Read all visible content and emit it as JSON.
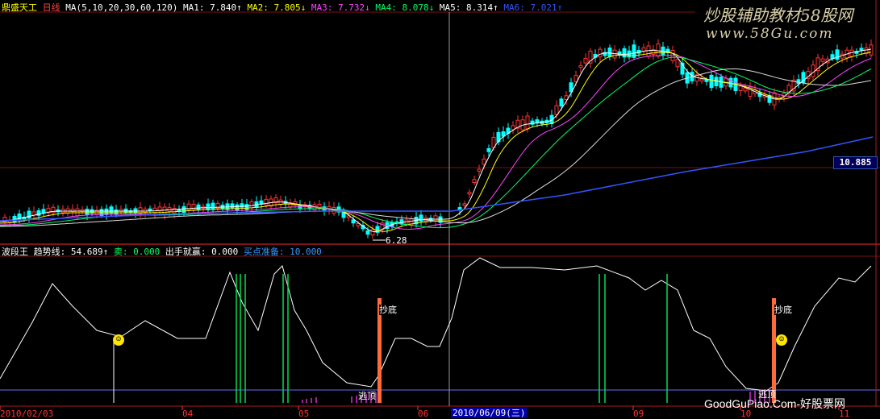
{
  "top_bar": {
    "stock_name": "鼎盛天工",
    "period": "日线",
    "ma_params": "MA(5,10,20,30,60,120)",
    "ma": [
      {
        "label": "MA1: 7.840↑",
        "color": "#ffffff"
      },
      {
        "label": "MA2: 7.805↓",
        "color": "#ffff00"
      },
      {
        "label": "MA3: 7.732↓",
        "color": "#ff44ff"
      },
      {
        "label": "MA4: 8.078↓",
        "color": "#00ff66"
      },
      {
        "label": "MA5: 8.314↑",
        "color": "#ffffff"
      },
      {
        "label": "MA6: 7.021↑",
        "color": "#3355ff"
      }
    ]
  },
  "watermark": {
    "brand": "炒股辅助教材58股网",
    "url": "www.58Gu.com",
    "bottom": "GoodGuPiao.Com-好股票网"
  },
  "price_panel": {
    "current_price_label": "10.885",
    "low_marker": "6.28"
  },
  "indicator_panel": {
    "name": "波段王",
    "values": [
      {
        "label": "趋势线: 54.689↑",
        "color": "#ffffff"
      },
      {
        "label": "卖: 0.000",
        "color": "#00ff66"
      },
      {
        "label": "出手就赢: 0.000",
        "color": "#ffffff"
      },
      {
        "label": "买点准备: 10.000",
        "color": "#3399ff"
      }
    ],
    "annotations": {
      "bottom_fish": "抄底",
      "escape": "逃顶"
    }
  },
  "x_axis": {
    "labels": [
      "2010/02/03",
      "04",
      "05",
      "06",
      "2010/06/09(三)",
      "09",
      "10",
      "11"
    ]
  },
  "colors": {
    "background": "#000000",
    "up": "#ff3333",
    "down": "#00ffff",
    "grid": "#7a1010",
    "highlight_bar": "#ff6a3a"
  }
}
